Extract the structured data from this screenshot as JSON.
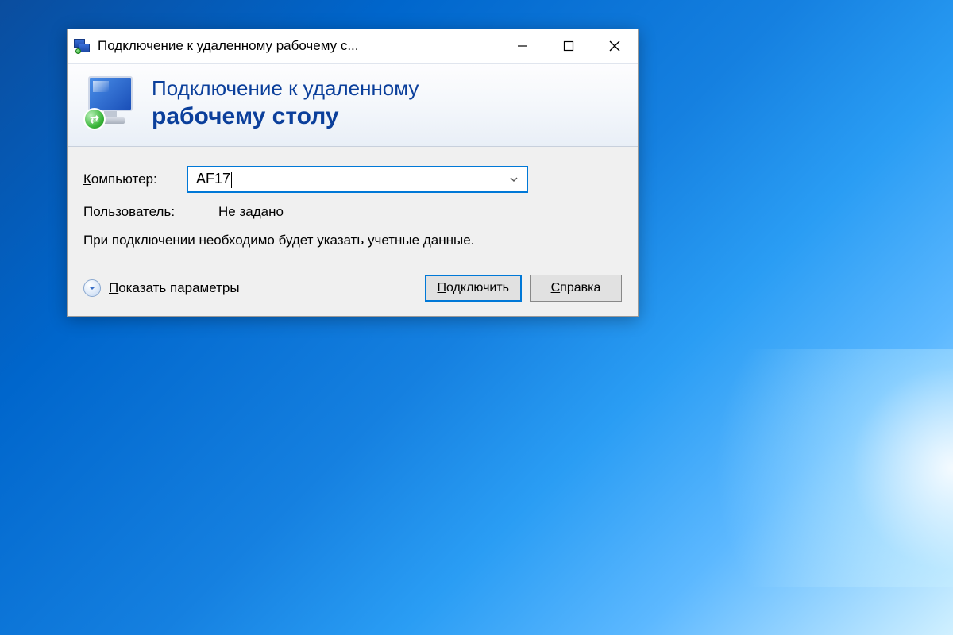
{
  "window": {
    "title": "Подключение к удаленному рабочему с..."
  },
  "header": {
    "line1": "Подключение к удаленному",
    "line2": "рабочему столу"
  },
  "form": {
    "computer_label_underline": "К",
    "computer_label_rest": "омпьютер:",
    "computer_value": "AF17",
    "user_label": "Пользователь:",
    "user_value": "Не задано",
    "info": "При подключении необходимо будет указать учетные данные."
  },
  "footer": {
    "options_underline": "П",
    "options_rest": "оказать параметры",
    "connect_underline": "П",
    "connect_rest": "одключить",
    "help_underline": "С",
    "help_rest": "правка"
  }
}
